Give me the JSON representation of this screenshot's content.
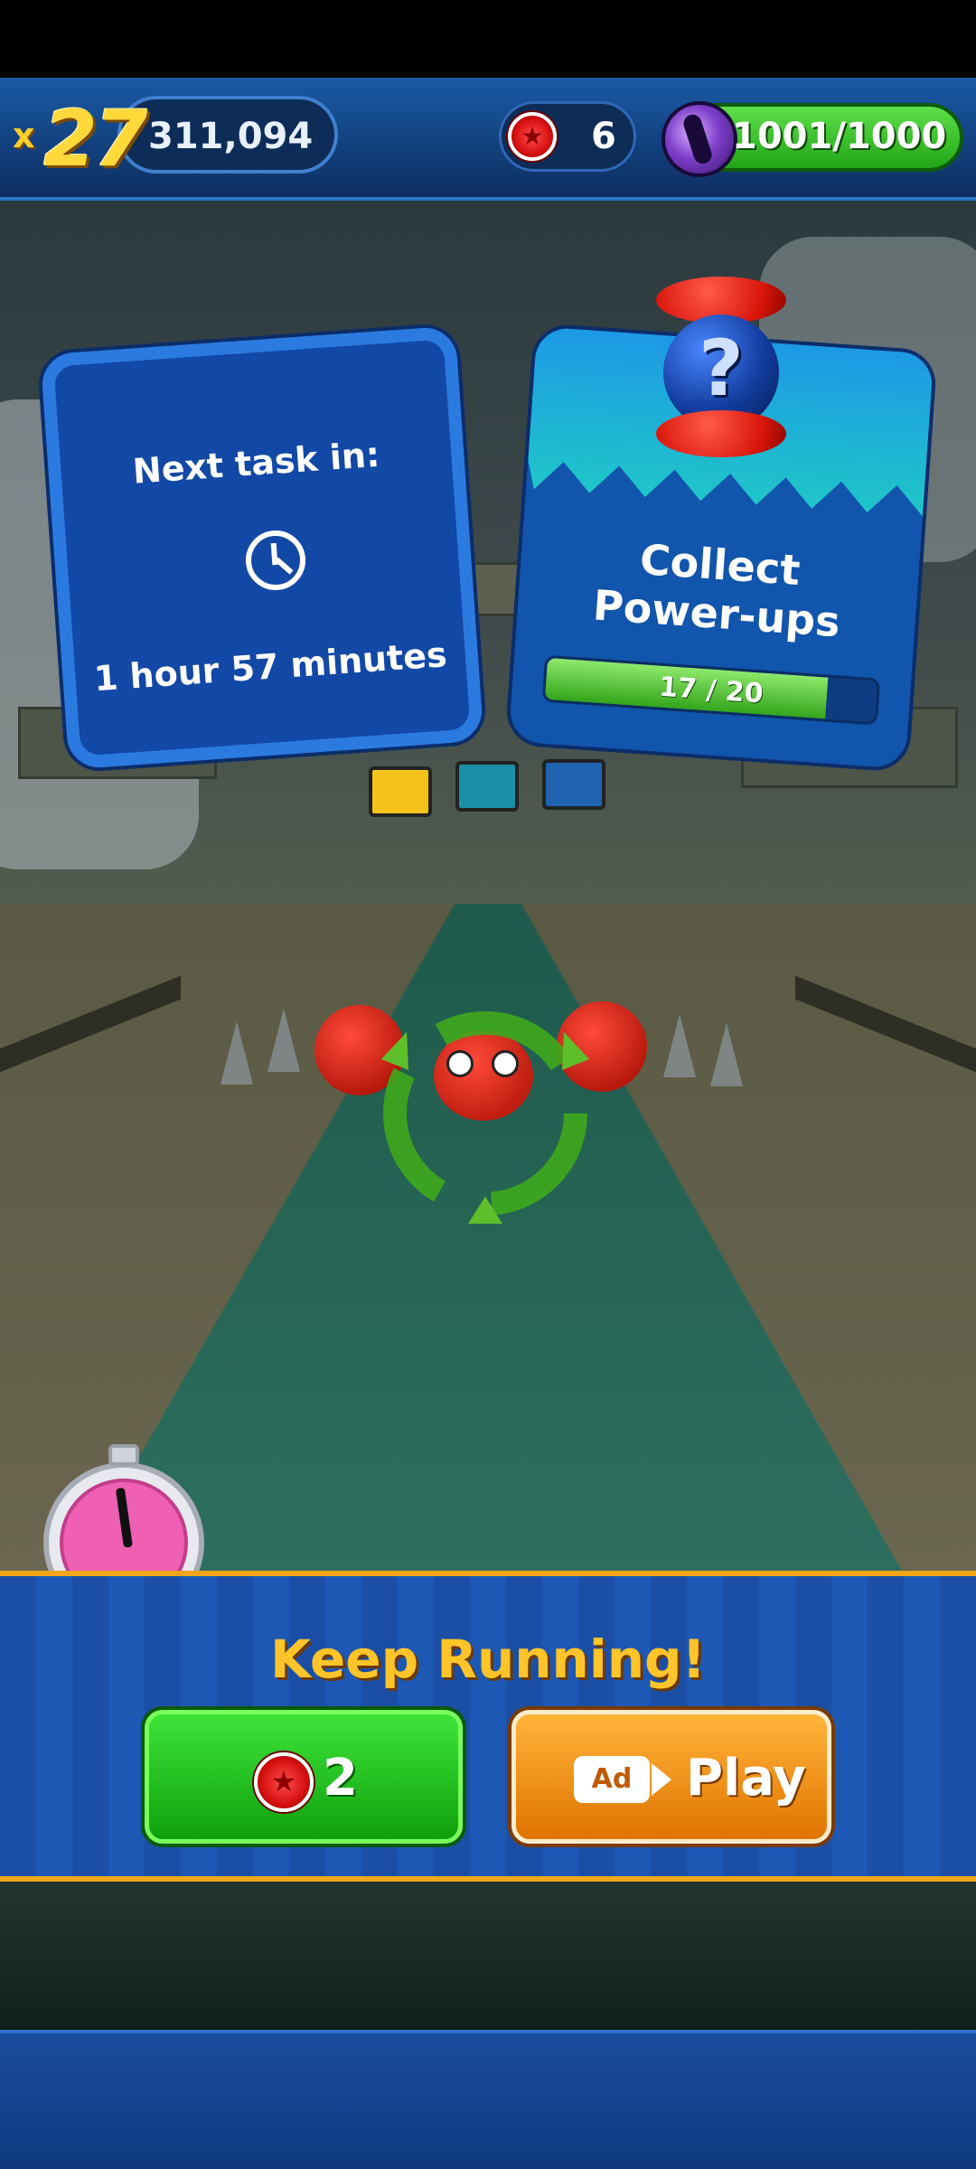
{
  "hud": {
    "multiplier_prefix": "x",
    "multiplier": "27",
    "score": "311,094",
    "red_rings": "6",
    "energy": "1001/1000"
  },
  "task_card": {
    "label": "Next task in:",
    "time_remaining": "1 hour 57 minutes"
  },
  "goal_card": {
    "title_line1": "Collect",
    "title_line2": "Power-ups",
    "progress_text": "17 / 20",
    "progress_fraction": 0.85
  },
  "continue_panel": {
    "title": "Keep Running!",
    "rings_cost": "2",
    "ad_badge": "Ad",
    "play_label": "Play"
  },
  "colors": {
    "panel_border": "#f3a619",
    "ring_red": "#d51010",
    "button_green": "#0fa00c",
    "button_orange": "#e07400"
  }
}
